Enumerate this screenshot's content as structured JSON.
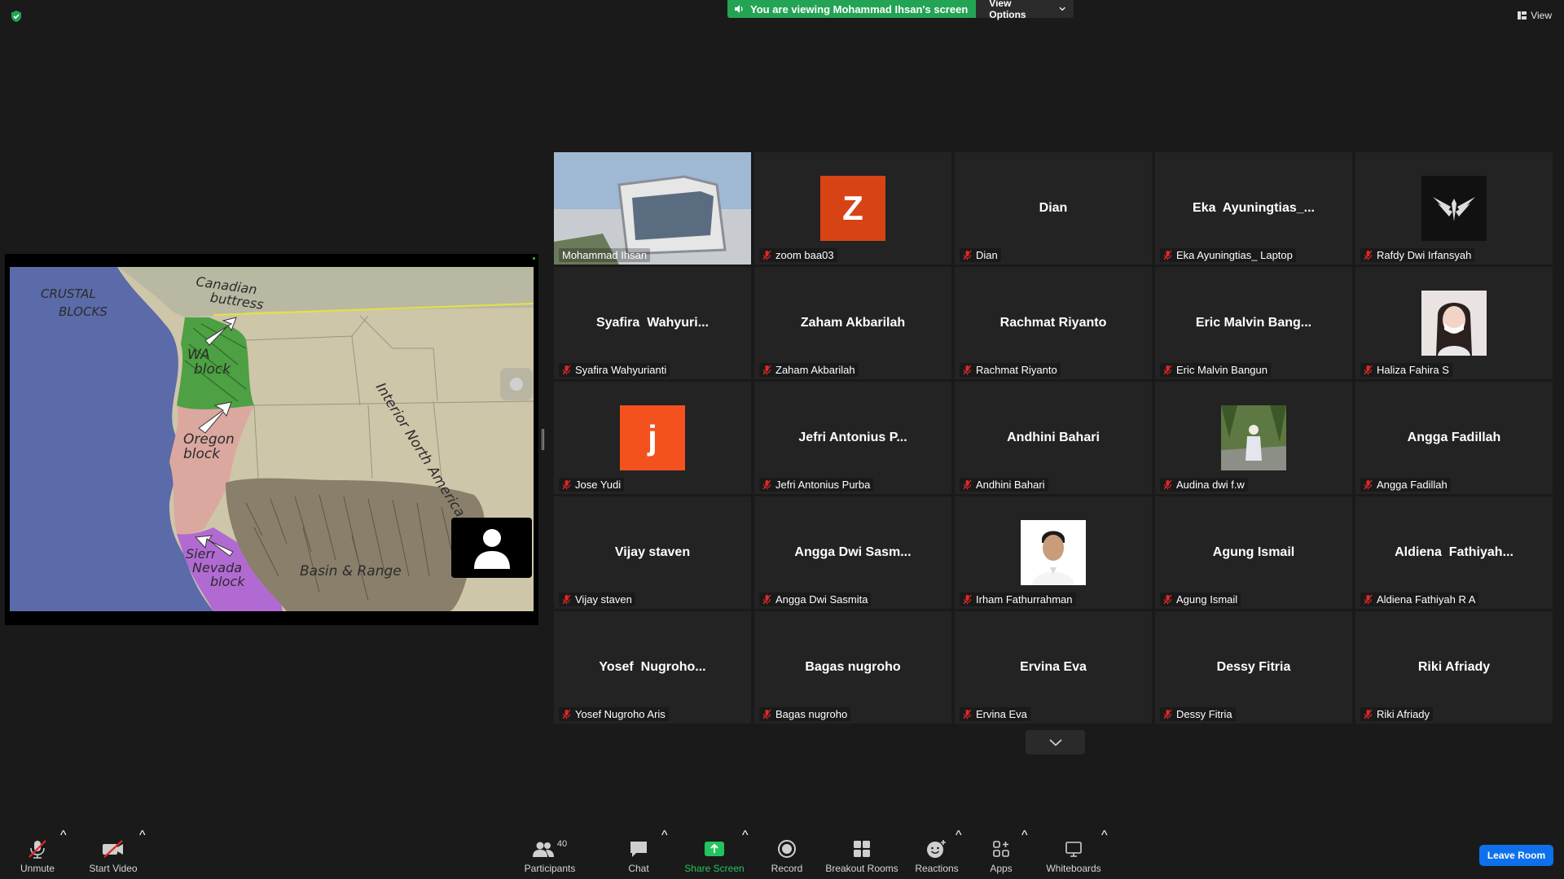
{
  "colors": {
    "banner_green": "#23a455",
    "active_speaker": "#d8e67a",
    "leave_button": "#0e71eb",
    "mic_muted": "#e02828"
  },
  "top_bar": {
    "banner_text": "You are viewing Mohammad Ihsan's screen",
    "view_options_label": "View Options",
    "view_label": "View"
  },
  "shared_screen": {
    "map_labels": {
      "crustal_1": "CRUSTAL",
      "crustal_2": "BLOCKS",
      "canadian_1": "Canadian",
      "canadian_2": "buttress",
      "wa_1": "WA",
      "wa_2": "block",
      "oregon_1": "Oregon",
      "oregon_2": "block",
      "sierra_1": "Sierra",
      "sierra_2": "Nevada",
      "sierra_3": "block",
      "interior": "Interior North America",
      "basin": "Basin & Range"
    }
  },
  "participants": [
    {
      "display": "",
      "label": "Mohammad Ihsan",
      "type": "video",
      "muted": false,
      "active": true
    },
    {
      "display": "Z",
      "label": "zoom baa03",
      "type": "avatar",
      "avatar_color": "#d84315",
      "muted": true
    },
    {
      "display": "Dian",
      "label": "Dian",
      "type": "name",
      "muted": true
    },
    {
      "display": "Eka  Ayuningtias_...",
      "label": "Eka Ayuningtias_ Laptop",
      "type": "name",
      "muted": true
    },
    {
      "display": "",
      "label": "Rafdy Dwi Irfansyah",
      "type": "logo",
      "muted": true
    },
    {
      "display": "Syafira  Wahyuri...",
      "label": "Syafira Wahyurianti",
      "type": "name",
      "muted": true
    },
    {
      "display": "Zaham Akbarilah",
      "label": "Zaham Akbarilah",
      "type": "name",
      "muted": true
    },
    {
      "display": "Rachmat Riyanto",
      "label": "Rachmat Riyanto",
      "type": "name",
      "muted": true
    },
    {
      "display": "Eric Malvin Bang...",
      "label": "Eric Malvin Bangun",
      "type": "name",
      "muted": true
    },
    {
      "display": "",
      "label": "Haliza Fahira S",
      "type": "photo-woman",
      "muted": true
    },
    {
      "display": "j",
      "label": "Jose Yudi",
      "type": "avatar",
      "avatar_color": "#f4511e",
      "muted": true
    },
    {
      "display": "Jefri Antonius P...",
      "label": "Jefri Antonius Purba",
      "type": "name",
      "muted": true
    },
    {
      "display": "Andhini Bahari",
      "label": "Andhini Bahari",
      "type": "name",
      "muted": true
    },
    {
      "display": "",
      "label": "Audina dwi f.w",
      "type": "photo-nature",
      "muted": true
    },
    {
      "display": "Angga Fadillah",
      "label": "Angga Fadillah",
      "type": "name",
      "muted": true
    },
    {
      "display": "Vijay staven",
      "label": "Vijay staven",
      "type": "name",
      "muted": true
    },
    {
      "display": "Angga Dwi Sasm...",
      "label": "Angga Dwi Sasmita",
      "type": "name",
      "muted": true
    },
    {
      "display": "",
      "label": "Irham Fathurrahman",
      "type": "photo-man",
      "muted": true
    },
    {
      "display": "Agung Ismail",
      "label": "Agung Ismail",
      "type": "name",
      "muted": true
    },
    {
      "display": "Aldiena  Fathiyah...",
      "label": "Aldiena Fathiyah R A",
      "type": "name",
      "muted": true
    },
    {
      "display": "Yosef  Nugroho...",
      "label": "Yosef Nugroho Aris",
      "type": "name",
      "muted": true
    },
    {
      "display": "Bagas nugroho",
      "label": "Bagas nugroho",
      "type": "name",
      "muted": true
    },
    {
      "display": "Ervina Eva",
      "label": "Ervina Eva",
      "type": "name",
      "muted": true
    },
    {
      "display": "Dessy Fitria",
      "label": "Dessy Fitria",
      "type": "name",
      "muted": true
    },
    {
      "display": "Riki Afriady",
      "label": "Riki Afriady",
      "type": "name",
      "muted": true
    }
  ],
  "toolbar": {
    "unmute": "Unmute",
    "start_video": "Start Video",
    "participants": "Participants",
    "participants_count": "40",
    "chat": "Chat",
    "share_screen": "Share Screen",
    "record": "Record",
    "breakout_rooms": "Breakout Rooms",
    "reactions": "Reactions",
    "apps": "Apps",
    "whiteboards": "Whiteboards",
    "leave_room": "Leave Room"
  }
}
